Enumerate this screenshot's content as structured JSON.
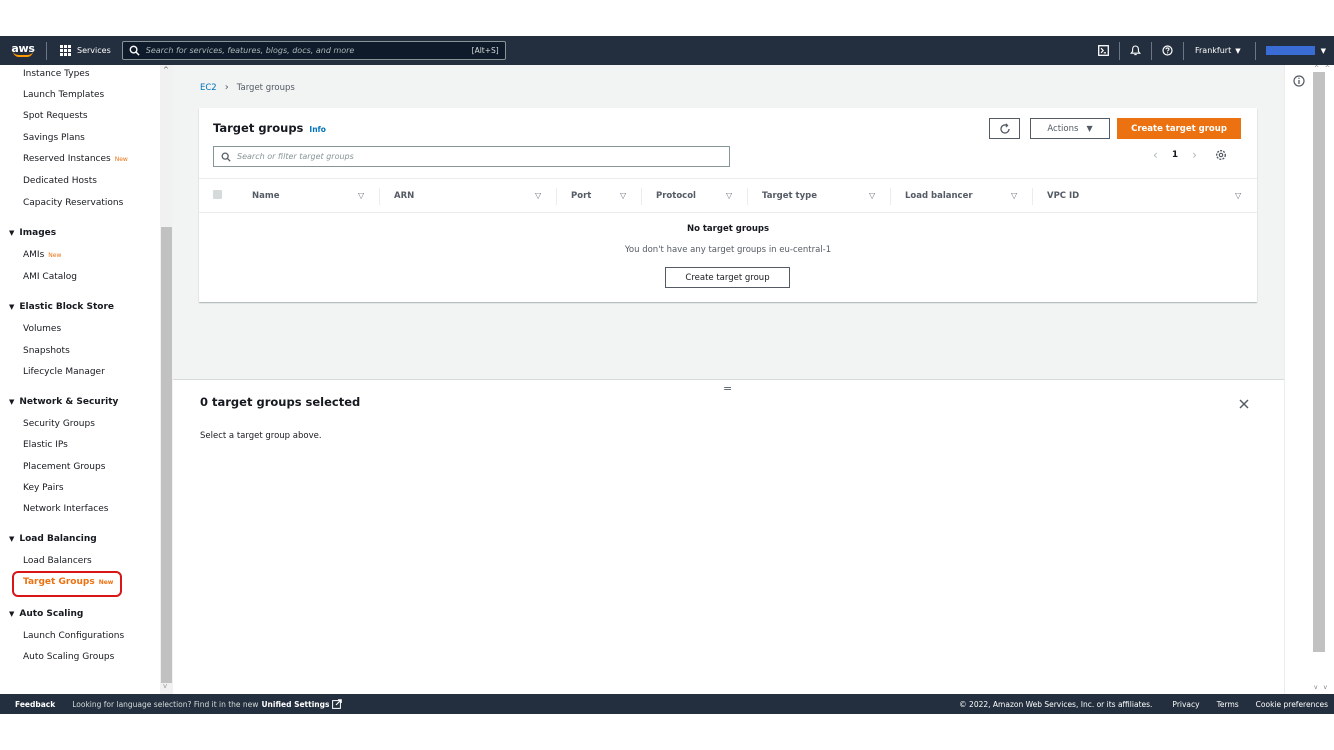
{
  "topnav": {
    "logo_text": "aws",
    "services_label": "Services",
    "search_placeholder": "Search for services, features, blogs, docs, and more",
    "search_shortcut": "[Alt+S]",
    "region_label": "Frankfurt",
    "icons": [
      "cloudshell-icon",
      "bell-icon",
      "help-icon"
    ],
    "account_color": "#3a6cd6"
  },
  "sidebar": {
    "items": [
      {
        "label": "Instance Types"
      },
      {
        "label": "Launch Templates"
      },
      {
        "label": "Spot Requests"
      },
      {
        "label": "Savings Plans"
      },
      {
        "label": "Reserved Instances",
        "badge": "New"
      },
      {
        "label": "Dedicated Hosts"
      },
      {
        "label": "Capacity Reservations"
      }
    ],
    "images": {
      "heading": "Images",
      "items": [
        {
          "label": "AMIs",
          "badge": "New"
        },
        {
          "label": "AMI Catalog"
        }
      ]
    },
    "ebs": {
      "heading": "Elastic Block Store",
      "items": [
        {
          "label": "Volumes"
        },
        {
          "label": "Snapshots"
        },
        {
          "label": "Lifecycle Manager"
        }
      ]
    },
    "netsec": {
      "heading": "Network & Security",
      "items": [
        {
          "label": "Security Groups"
        },
        {
          "label": "Elastic IPs"
        },
        {
          "label": "Placement Groups"
        },
        {
          "label": "Key Pairs"
        },
        {
          "label": "Network Interfaces"
        }
      ]
    },
    "lb": {
      "heading": "Load Balancing",
      "items": [
        {
          "label": "Load Balancers"
        },
        {
          "label": "Target Groups",
          "badge": "New"
        }
      ]
    },
    "as": {
      "heading": "Auto Scaling",
      "items": [
        {
          "label": "Launch Configurations"
        },
        {
          "label": "Auto Scaling Groups"
        }
      ]
    },
    "highlight_color": "#d91515",
    "active_color": "#ec7211"
  },
  "breadcrumb": {
    "root": "EC2",
    "current": "Target groups"
  },
  "panel": {
    "title": "Target groups",
    "info_label": "Info",
    "actions_label": "Actions",
    "create_label": "Create target group",
    "filter_placeholder": "Search or filter target groups",
    "page_number": "1",
    "columns": [
      "Name",
      "ARN",
      "Port",
      "Protocol",
      "Target type",
      "Load balancer",
      "VPC ID"
    ],
    "empty_title": "No target groups",
    "empty_sub": "You don't have any target groups in eu-central-1",
    "empty_button": "Create target group",
    "primary_color": "#ec7211"
  },
  "split": {
    "title": "0 target groups selected",
    "text": "Select a target group above."
  },
  "footer": {
    "feedback": "Feedback",
    "lang_text": "Looking for language selection? Find it in the new",
    "unified_label": "Unified Settings",
    "copyright": "© 2022, Amazon Web Services, Inc. or its affiliates.",
    "links": [
      "Privacy",
      "Terms",
      "Cookie preferences"
    ]
  }
}
